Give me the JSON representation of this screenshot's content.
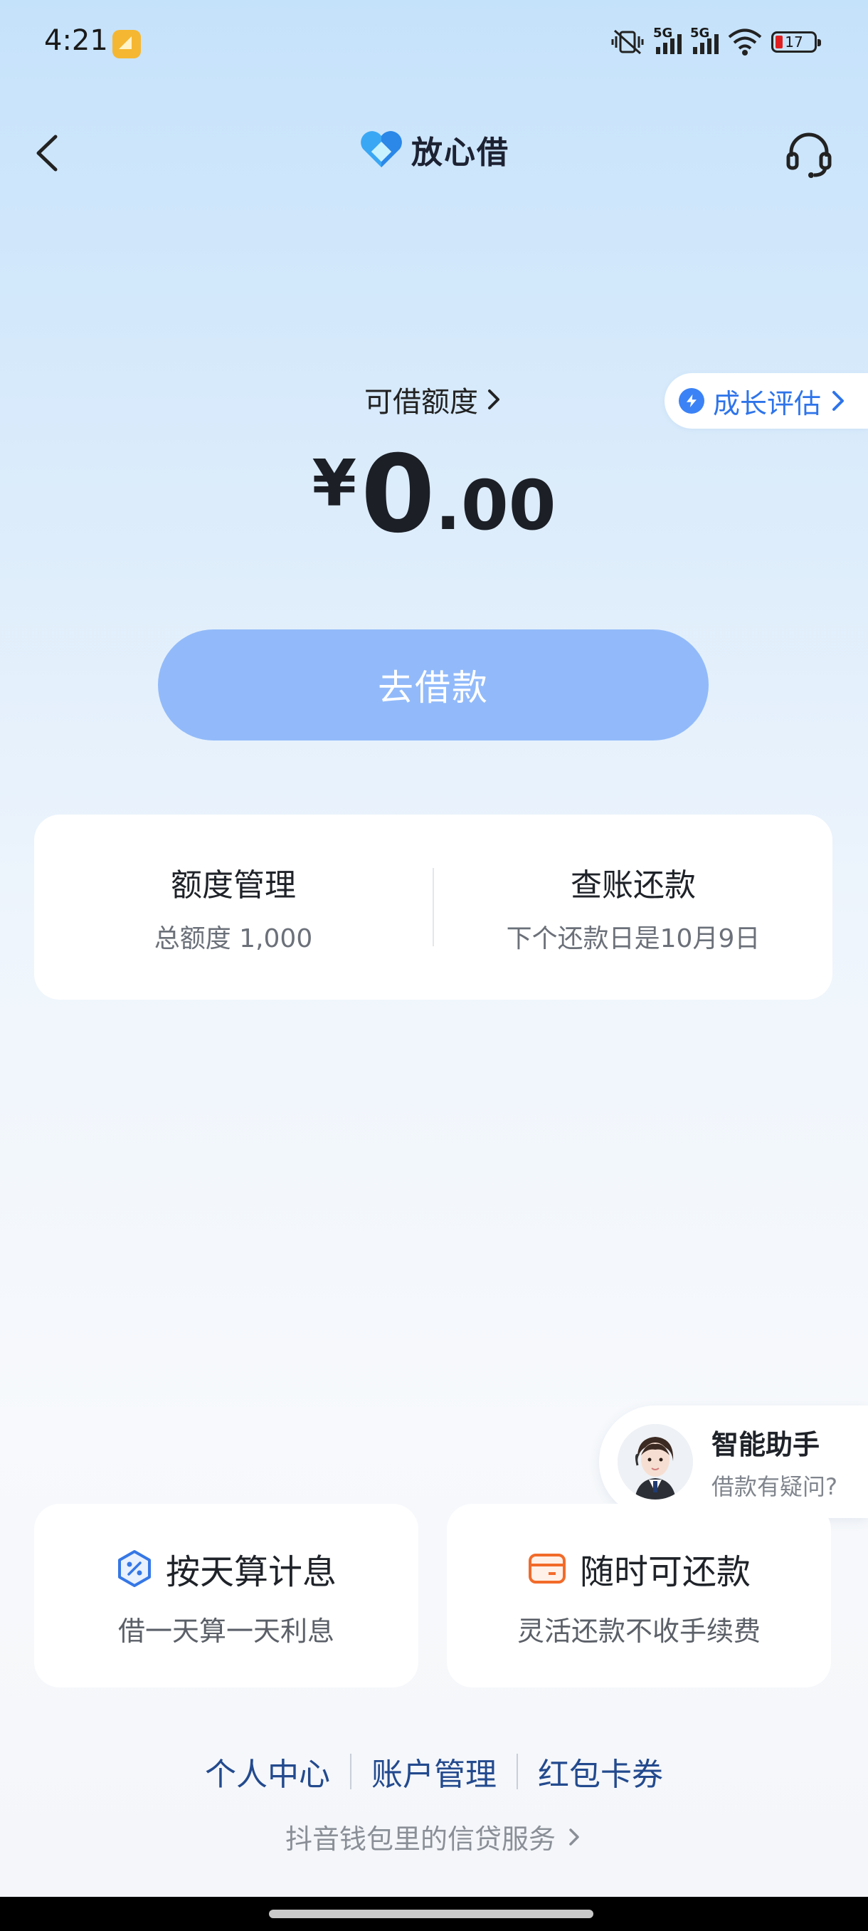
{
  "status_bar": {
    "time": "4:21",
    "network_1": "5G",
    "network_2": "5G",
    "battery": "17"
  },
  "header": {
    "title": "放心借"
  },
  "credit": {
    "label": "可借额度",
    "currency": "¥",
    "amount_int": "0",
    "amount_dec": ".00",
    "growth_label": "成长评估"
  },
  "borrow_button": "去借款",
  "management": {
    "limit_title": "额度管理",
    "limit_sub": "总额度 1,000",
    "bill_title": "查账还款",
    "bill_sub": "下个还款日是10月9日"
  },
  "assistant": {
    "title": "智能助手",
    "subtitle": "借款有疑问?"
  },
  "features": [
    {
      "title": "按天算计息",
      "subtitle": "借一天算一天利息"
    },
    {
      "title": "随时可还款",
      "subtitle": "灵活还款不收手续费"
    }
  ],
  "footer": {
    "links": [
      "个人中心",
      "账户管理",
      "红包卡券"
    ],
    "note": "抖音钱包里的信贷服务"
  },
  "colors": {
    "accent": "#2e74ea",
    "button": "#92bafa",
    "link": "#234a8e"
  }
}
